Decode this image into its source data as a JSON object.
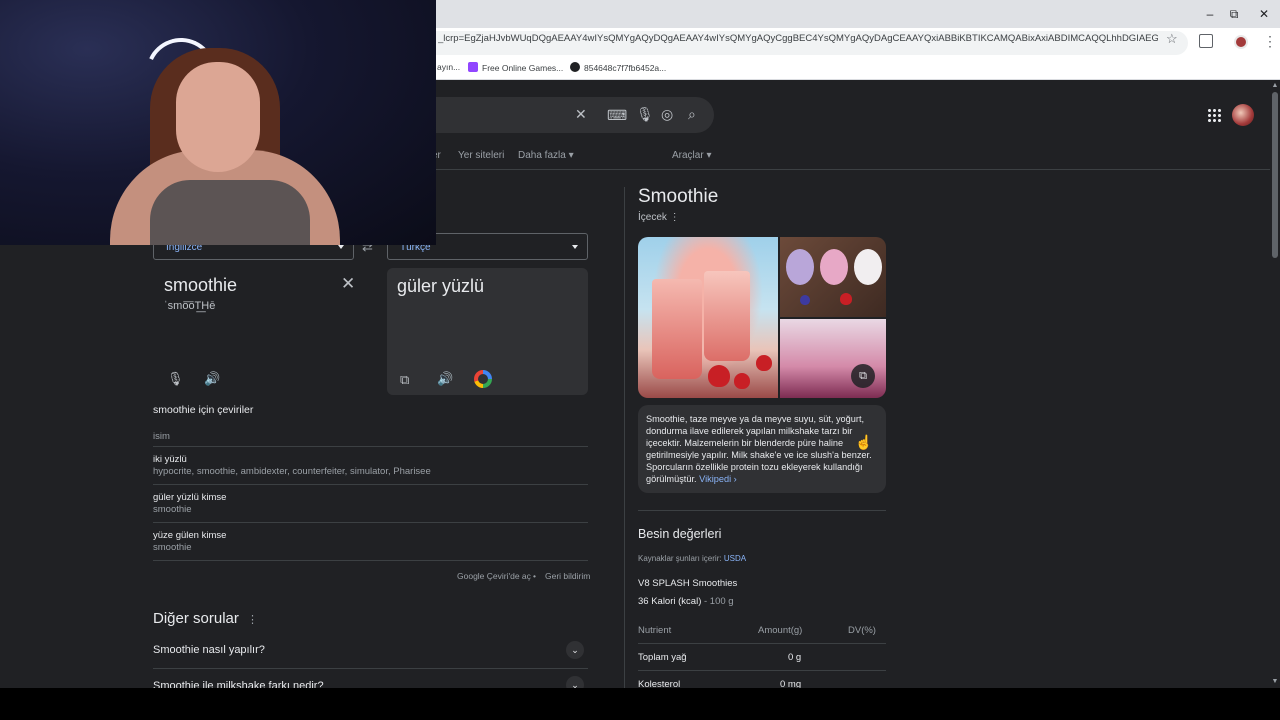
{
  "browser": {
    "window_controls": {
      "minimize": "–",
      "restore": "⧉",
      "close": "✕"
    },
    "url": "_lcrp=EgZjaHJvbWUqDQgAEAAY4wIYsQMYgAQyDQgAEAAY4wIYsQMYgAQyCggBEC4YsQMYgAQyDAgCEAAYQxiABBiKBTIKCAMQABixAxiABDIMCAQQLhhDGIAEGIoFMgoIBR...",
    "bookmarks": [
      {
        "label": "ayın...",
        "icon": "bookmark-icon"
      },
      {
        "label": "Free Online Games...",
        "icon": "twitch-icon",
        "color": "#9146ff"
      },
      {
        "label": "854648c7f7fb6452a...",
        "icon": "globe-icon",
        "color": "#202124"
      }
    ]
  },
  "search": {
    "tabs": [
      {
        "label": "er"
      },
      {
        "label": "Yer siteleri"
      },
      {
        "label": "Daha fazla"
      },
      {
        "label": "Araçlar"
      }
    ]
  },
  "translate": {
    "source_lang": "İngilizce",
    "target_lang": "Türkçe",
    "source_text": "smoothie",
    "phonetic": "ˈsmo͞oT͟Hē",
    "target_text": "güler yüzlü",
    "section_title": "smoothie için çeviriler",
    "part_of_speech": "isim",
    "translations": [
      {
        "word": "iki yüzlü",
        "synonyms": "hypocrite, smoothie, ambidexter, counterfeiter, simulator, Pharisee"
      },
      {
        "word": "güler yüzlü kimse",
        "synonyms": "smoothie"
      },
      {
        "word": "yüze gülen kimse",
        "synonyms": "smoothie"
      }
    ],
    "footer_open": "Google Çeviri'de aç",
    "footer_feedback": "Geri bildirim"
  },
  "other_questions": {
    "title": "Diğer sorular",
    "items": [
      "Smoothie nasıl yapılır?",
      "Smoothie ile milkshake farkı nedir?"
    ]
  },
  "knowledge_panel": {
    "title": "Smoothie",
    "subtitle": "İçecek",
    "description": "Smoothie, taze meyve ya da meyve suyu, süt, yoğurt, dondurma ilave edilerek yapılan milkshake tarzı bir içecektir. Malzemelerin bir blenderde püre haline getirilmesiyle yapılır. Milk shake'e ve ice slush'a benzer. Sporcuların özellikle protein tozu ekleyerek kullandığı görülmüştür.",
    "wiki_link": "Vikipedi ›",
    "nutrition_title": "Besin değerleri",
    "source_prefix": "Kaynaklar şunları içerir:",
    "source_name": "USDA",
    "product": "V8 SPLASH Smoothies",
    "calories": "36 Kalori (kcal)",
    "serving": "- 100 g",
    "table_headers": [
      "Nutrient",
      "Amount(g)",
      "DV(%)"
    ],
    "rows": [
      {
        "nutrient": "Toplam yağ",
        "amount": "0 g",
        "dv": ""
      },
      {
        "nutrient": "Kolesterol",
        "amount": "0 mg",
        "dv": ""
      }
    ]
  }
}
